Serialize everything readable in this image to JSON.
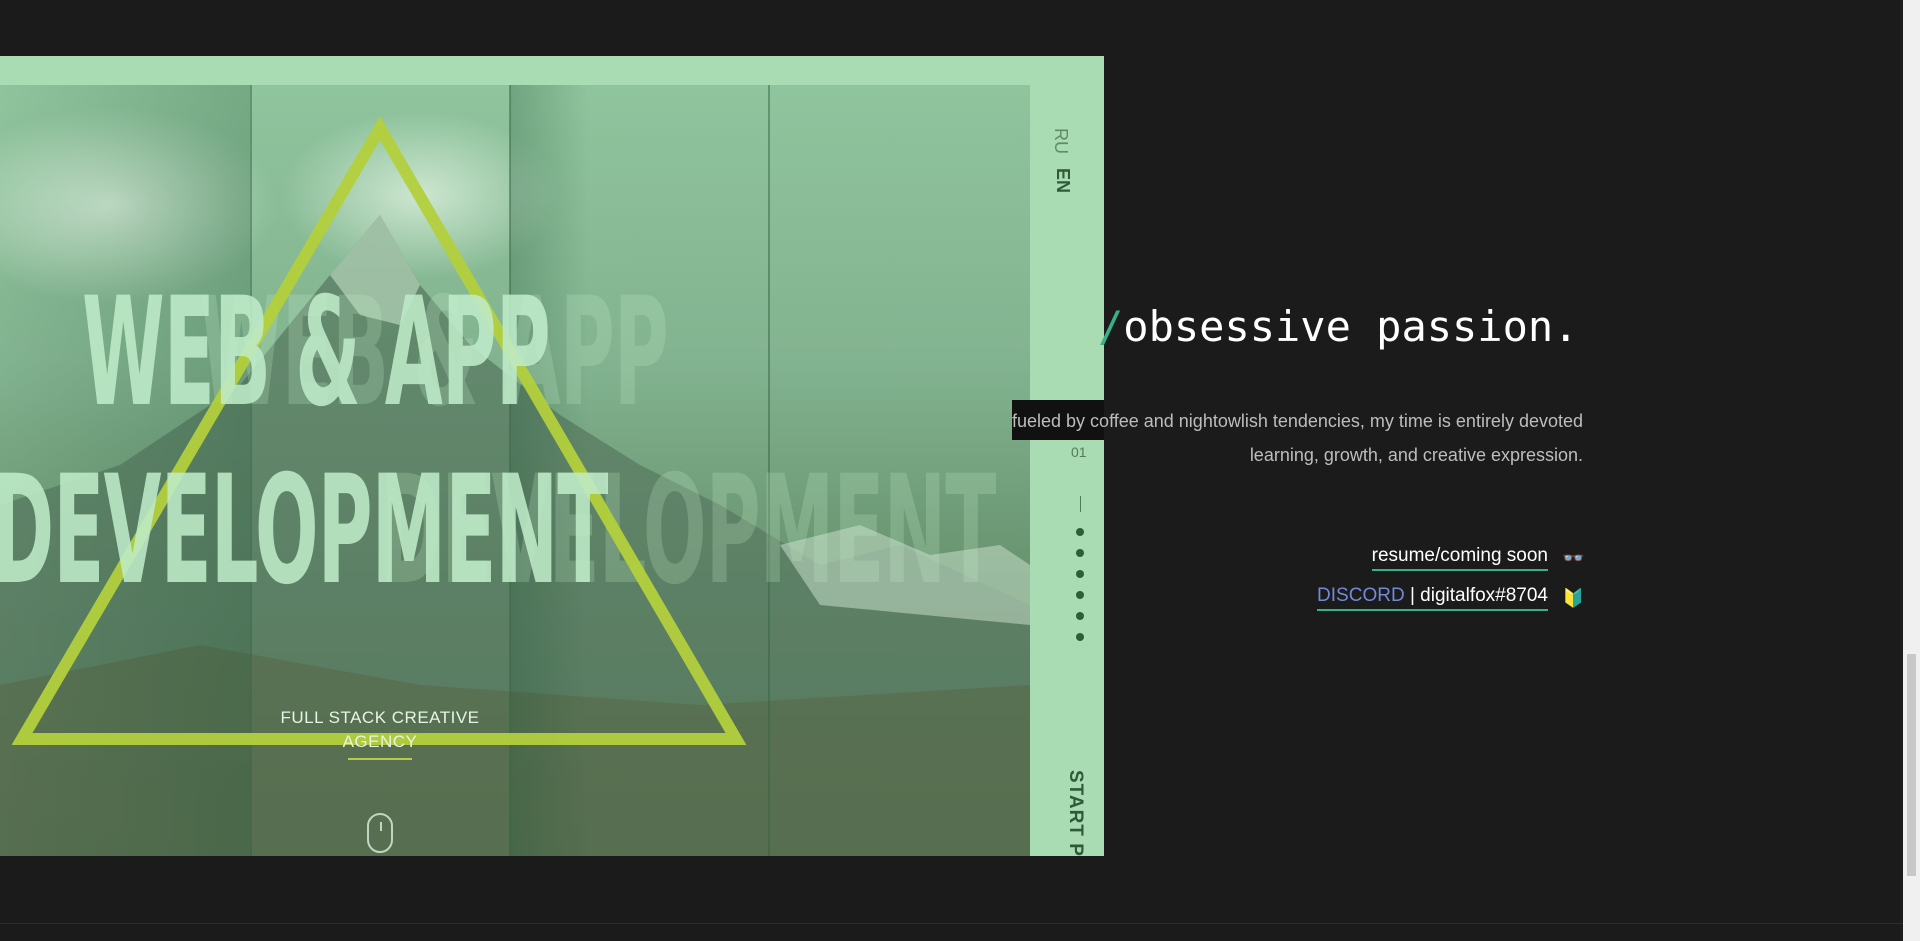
{
  "showcase": {
    "title_line1": "WEB & APP",
    "title_line2": "DEVELOPMENT",
    "agency_line1": "FULL STACK CREATIVE",
    "agency_line2": "AGENCY",
    "lang_ru": "RU",
    "lang_en": "EN",
    "counter": "01",
    "start_project": "START PROJECT",
    "accent_color": "#b3cf3c"
  },
  "headline": {
    "slash": "/",
    "text": "obsessive passion."
  },
  "description": "fueled by coffee and nightowlish tendencies, my time is entirely devoted learning, growth, and creative expression.",
  "links": {
    "resume": "resume/coming soon",
    "resume_emoji": "👓",
    "discord_label": "DISCORD",
    "separator": "|",
    "discord_tag": "digitalfox#8704",
    "discord_emoji": "🔰"
  },
  "colors": {
    "background": "#1b1b1b",
    "teal_accent": "#3ab089",
    "discord_blue": "#7289da"
  }
}
